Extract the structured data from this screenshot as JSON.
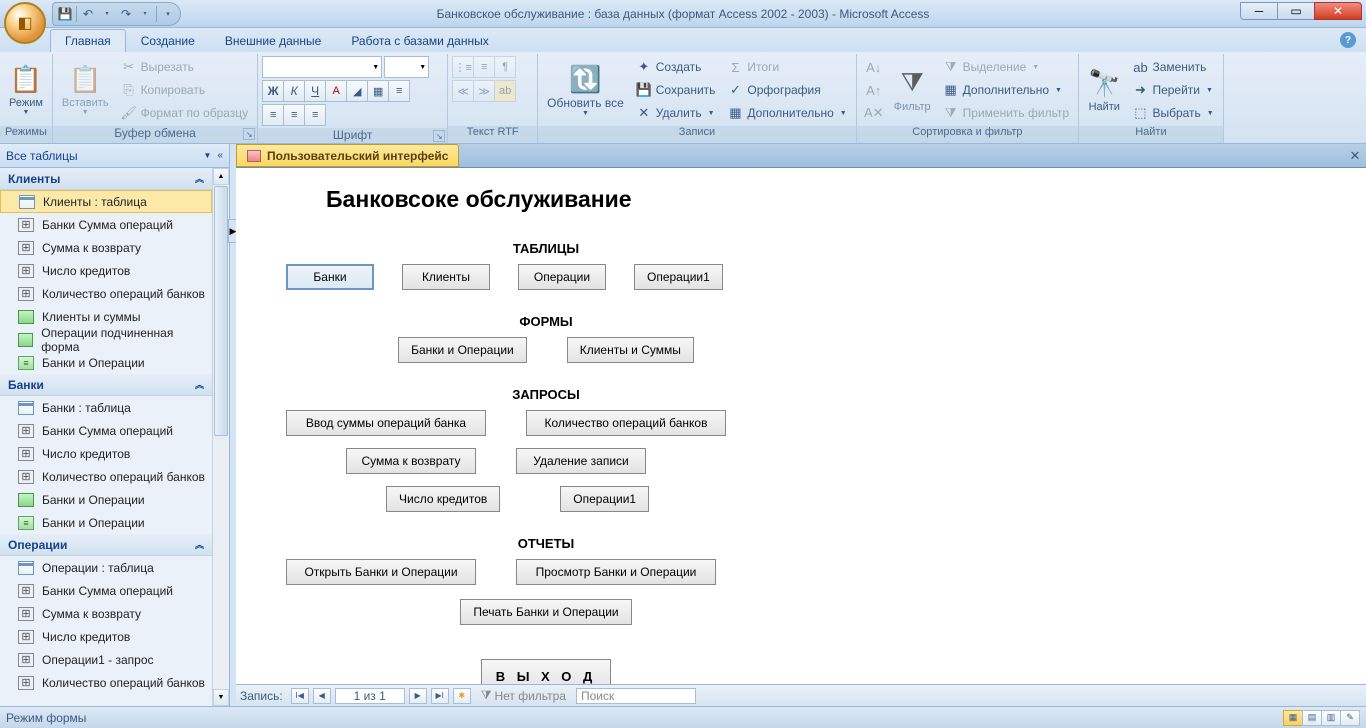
{
  "app": {
    "title": "Банковское обслуживание : база данных (формат Access 2002 - 2003) - Microsoft Access"
  },
  "tabs": {
    "home": "Главная",
    "create": "Создание",
    "external": "Внешние данные",
    "dbtools": "Работа с базами данных"
  },
  "ribbon": {
    "views": {
      "label": "Режимы",
      "view": "Режим"
    },
    "clipboard": {
      "label": "Буфер обмена",
      "paste": "Вставить",
      "cut": "Вырезать",
      "copy": "Копировать",
      "painter": "Формат по образцу"
    },
    "font": {
      "label": "Шрифт"
    },
    "richtext": {
      "label": "Текст RTF"
    },
    "records": {
      "label": "Записи",
      "refresh": "Обновить все",
      "new": "Создать",
      "save": "Сохранить",
      "delete": "Удалить",
      "totals": "Итоги",
      "spelling": "Орфография",
      "more": "Дополнительно"
    },
    "sortfilter": {
      "label": "Сортировка и фильтр",
      "filter": "Фильтр",
      "selection": "Выделение",
      "advanced": "Дополнительно",
      "toggle": "Применить фильтр"
    },
    "find": {
      "label": "Найти",
      "find_btn": "Найти",
      "replace": "Заменить",
      "goto": "Перейти",
      "select": "Выбрать"
    }
  },
  "nav": {
    "title": "Все таблицы",
    "groups": [
      {
        "name": "Клиенты",
        "items": [
          {
            "label": "Клиенты : таблица",
            "type": "table",
            "sel": true
          },
          {
            "label": "Банки Сумма операций",
            "type": "query"
          },
          {
            "label": "Сумма к возврату",
            "type": "query"
          },
          {
            "label": "Число кредитов",
            "type": "query"
          },
          {
            "label": "Количество операций банков",
            "type": "query"
          },
          {
            "label": "Клиенты и суммы",
            "type": "form"
          },
          {
            "label": "Операции подчиненная форма",
            "type": "form"
          },
          {
            "label": "Банки и Операции",
            "type": "report"
          }
        ]
      },
      {
        "name": "Банки",
        "items": [
          {
            "label": "Банки : таблица",
            "type": "table"
          },
          {
            "label": "Банки Сумма операций",
            "type": "query"
          },
          {
            "label": "Число кредитов",
            "type": "query"
          },
          {
            "label": "Количество операций банков",
            "type": "query"
          },
          {
            "label": "Банки и Операции",
            "type": "form"
          },
          {
            "label": "Банки и Операции",
            "type": "report"
          }
        ]
      },
      {
        "name": "Операции",
        "items": [
          {
            "label": "Операции : таблица",
            "type": "table"
          },
          {
            "label": "Банки Сумма операций",
            "type": "query"
          },
          {
            "label": "Сумма к возврату",
            "type": "query"
          },
          {
            "label": "Число кредитов",
            "type": "query"
          },
          {
            "label": "Операции1 - запрос",
            "type": "query"
          },
          {
            "label": "Количество операций банков",
            "type": "query"
          }
        ]
      }
    ]
  },
  "doc": {
    "tab_title": "Пользовательский интерфейс",
    "form": {
      "title": "Банковсоке обслуживание",
      "sec_tables": "ТАБЛИЦЫ",
      "sec_forms": "ФОРМЫ",
      "sec_queries": "ЗАПРОСЫ",
      "sec_reports": "ОТЧЕТЫ",
      "btn_banks": "Банки",
      "btn_clients": "Клиенты",
      "btn_ops": "Операции",
      "btn_ops1": "Операции1",
      "btn_banks_ops": "Банки и Операции",
      "btn_clients_sums": "Клиенты и Суммы",
      "btn_input_sum": "Ввод суммы операций банка",
      "btn_count_ops": "Количество операций банков",
      "btn_return_sum": "Сумма к возврату",
      "btn_del_rec": "Удаление записи",
      "btn_num_credits": "Число кредитов",
      "btn_ops1_q": "Операции1",
      "btn_open_rep": "Открыть Банки и Операции",
      "btn_view_rep": "Просмотр Банки и Операции",
      "btn_print_rep": "Печать Банки и Операции",
      "btn_exit": "В Ы Х О Д"
    },
    "recnav": {
      "label": "Запись:",
      "counter": "1 из 1",
      "nofilter": "Нет фильтра",
      "search": "Поиск"
    }
  },
  "status": {
    "text": "Режим формы"
  }
}
